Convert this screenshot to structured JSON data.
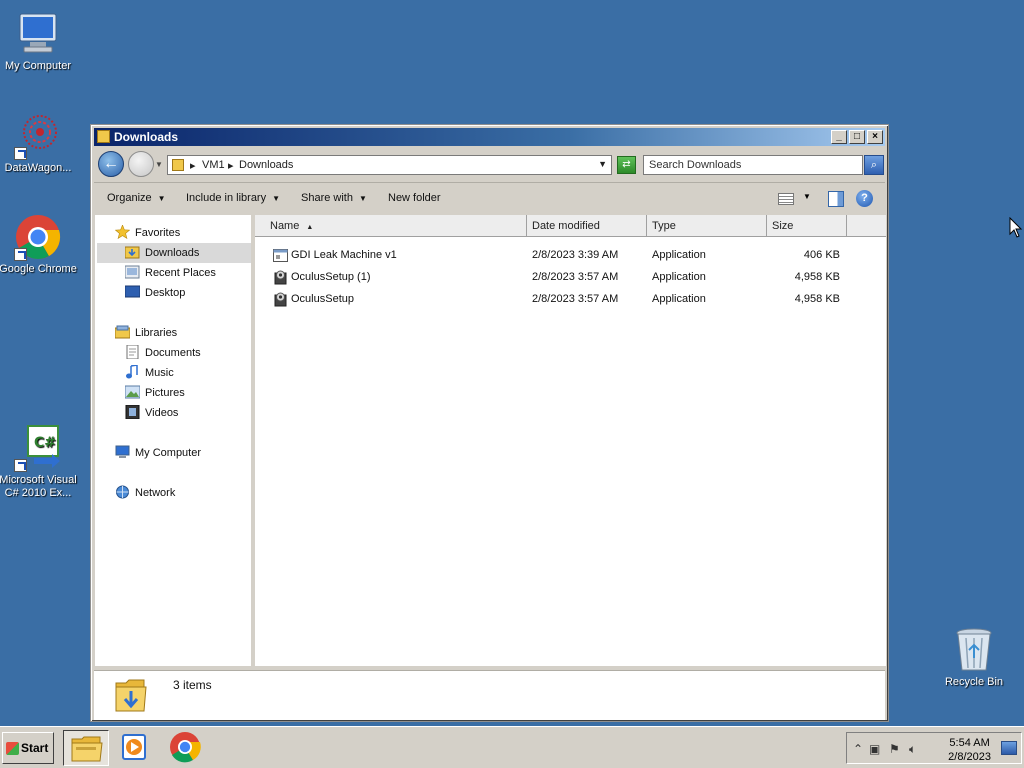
{
  "desktop": {
    "icons": [
      {
        "label": "My Computer"
      },
      {
        "label": "DataWagon..."
      },
      {
        "label": "Google Chrome"
      },
      {
        "label": "Microsoft Visual C# 2010 Ex..."
      },
      {
        "label": "Recycle Bin"
      }
    ]
  },
  "window": {
    "title": "Downloads",
    "address": {
      "crumbs": [
        "VM1",
        "Downloads"
      ]
    },
    "search": {
      "placeholder": "Search Downloads"
    },
    "toolbar": {
      "organize": "Organize",
      "include": "Include in library",
      "share": "Share with",
      "new_folder": "New folder"
    },
    "nav": {
      "favorites": "Favorites",
      "downloads": "Downloads",
      "recent": "Recent Places",
      "desktop": "Desktop",
      "libraries": "Libraries",
      "documents": "Documents",
      "music": "Music",
      "pictures": "Pictures",
      "videos": "Videos",
      "computer": "My Computer",
      "network": "Network"
    },
    "columns": {
      "name": "Name",
      "date": "Date modified",
      "type": "Type",
      "size": "Size"
    },
    "files": [
      {
        "name": "GDI Leak Machine v1",
        "date": "2/8/2023 3:39 AM",
        "type": "Application",
        "size": "406 KB"
      },
      {
        "name": "OculusSetup (1)",
        "date": "2/8/2023 3:57 AM",
        "type": "Application",
        "size": "4,958 KB"
      },
      {
        "name": "OculusSetup",
        "date": "2/8/2023 3:57 AM",
        "type": "Application",
        "size": "4,958 KB"
      }
    ],
    "details": {
      "count": "3 items"
    }
  },
  "taskbar": {
    "start": "Start",
    "clock_time": "5:54 AM",
    "clock_date": "2/8/2023"
  },
  "colors": {
    "desktop": "#3a6ea5",
    "titlebar": "#0a246a"
  }
}
